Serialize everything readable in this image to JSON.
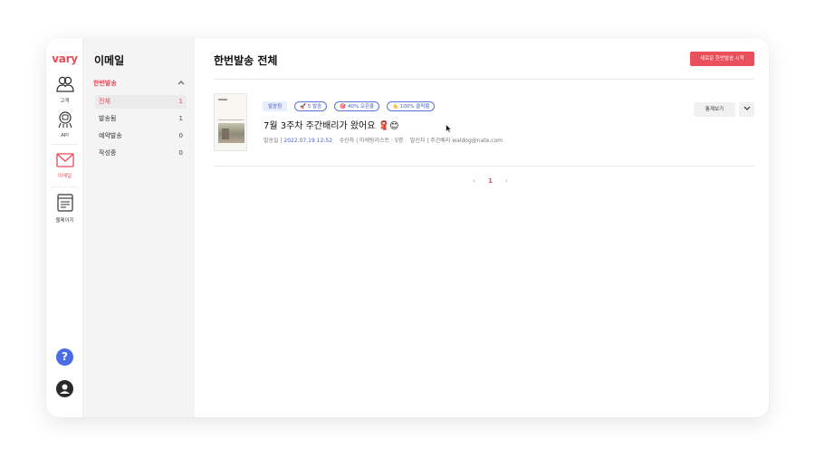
{
  "rail": {
    "logo": "vary",
    "items": [
      {
        "label": "고객",
        "icon": "customers-icon"
      },
      {
        "label": "API",
        "icon": "api-icon"
      },
      {
        "label": "이메일",
        "icon": "email-icon"
      },
      {
        "label": "웹페이지",
        "icon": "webpage-icon"
      }
    ],
    "help": "?",
    "accent_color": "#e84c5a"
  },
  "submenu": {
    "title": "이메일",
    "group": "한번발송",
    "items": [
      {
        "label": "전체",
        "count": "1"
      },
      {
        "label": "발송됨",
        "count": "1"
      },
      {
        "label": "예약발송",
        "count": "0"
      },
      {
        "label": "작성중",
        "count": "0"
      }
    ]
  },
  "main": {
    "title": "한번발송 전체",
    "new_button": "새로운 한번발송 시작",
    "mail": {
      "status": "발송됨",
      "badges": [
        "🚀 5 발송",
        "🎯 40% 오픈율",
        "👆 100% 클릭율"
      ],
      "title": "7월 3주차 주간배리가 왔어요 🧣😊",
      "sent_label": "발송일",
      "sent_date": "2022.07.19 12:52",
      "recipient_label": "수신자",
      "recipient": "마케팅리스트 · 5명",
      "sender_label": "발신자",
      "sender": "주간배리 waldog@nate.com",
      "stats_button": "통계보기"
    },
    "pagination": {
      "prev": "‹",
      "current": "1",
      "next": "›"
    }
  }
}
